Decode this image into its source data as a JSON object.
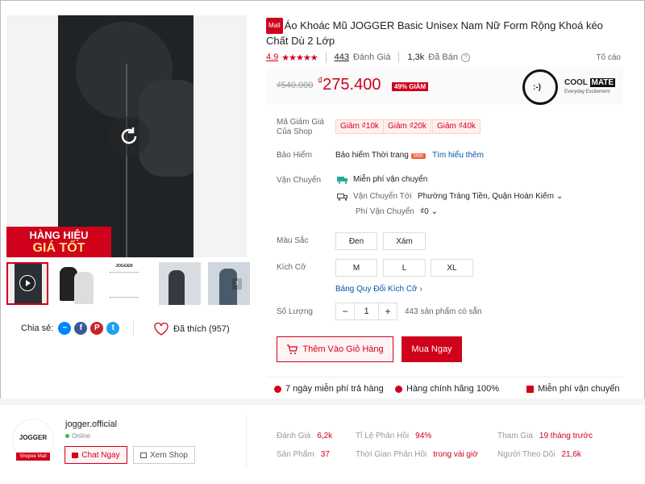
{
  "gallery": {
    "badge_line1": "HÀNG HIỆU",
    "badge_line2": "GIÁ TỐT",
    "thumb3_caption": "JOGGER"
  },
  "share": {
    "label": "Chia sẻ:",
    "icons": [
      "messenger-icon",
      "facebook-icon",
      "pinterest-icon",
      "twitter-icon"
    ],
    "liked_label": "Đã thích (957)"
  },
  "product": {
    "mall_tag": "Mall",
    "title": "Áo Khoác Mũ JOGGER Basic Unisex Nam Nữ Form Rộng Khoá kéo Chất Dù 2 Lớp",
    "rating": "4.9",
    "reviews_count": "443",
    "reviews_label": "Đánh Giá",
    "sold_count": "1,3k",
    "sold_label": "Đã Bán",
    "report": "Tố cáo"
  },
  "price": {
    "old": "₫540.000",
    "currency": "₫",
    "new": "275.400",
    "discount": "49% GIẢM"
  },
  "brand": {
    "name_left": "COOL",
    "name_right": "MATE",
    "tagline": "Everyday Excitement"
  },
  "vouchers": {
    "label": "Mã Giảm Giá Của Shop",
    "items": [
      "Giảm ₫10k",
      "Giảm ₫20k",
      "Giảm ₫40k"
    ]
  },
  "insurance": {
    "label": "Bảo Hiểm",
    "value": "Bảo hiểm Thời trang",
    "new_tag": "Mới",
    "learn_more": "Tìm hiểu thêm"
  },
  "shipping": {
    "label": "Vận Chuyển",
    "free": "Miễn phí vận chuyển",
    "to_label": "Vận Chuyển Tới",
    "to_value": "Phường Tràng Tiền, Quận Hoàn Kiếm",
    "fee_label": "Phí Vận Chuyển",
    "fee_value": "₫0"
  },
  "color": {
    "label": "Màu Sắc",
    "options": [
      "Đen",
      "Xám"
    ]
  },
  "size": {
    "label": "Kích Cỡ",
    "options": [
      "M",
      "L",
      "XL"
    ],
    "guide": "Bảng Quy Đổi Kích Cỡ"
  },
  "quantity": {
    "label": "Số Lượng",
    "minus": "−",
    "value": "1",
    "plus": "+",
    "stock": "443 sản phẩm có sẵn"
  },
  "actions": {
    "add_cart": "Thêm Vào Giỏ Hàng",
    "buy_now": "Mua Ngay"
  },
  "guarantees": {
    "return": "7 ngày miễn phí trả hàng",
    "genuine": "Hàng chính hãng 100%",
    "free_ship": "Miễn phí vận chuyển"
  },
  "shop": {
    "logo_text": "JOGGER",
    "mall_badge": "Shopee Mall",
    "name": "jogger.official",
    "status": "Online",
    "chat": "Chat Ngay",
    "view": "Xem Shop",
    "metrics": [
      {
        "k": "Đánh Giá",
        "v": "6,2k"
      },
      {
        "k": "Sản Phẩm",
        "v": "37"
      },
      {
        "k": "Tỉ Lệ Phản Hồi",
        "v": "94%"
      },
      {
        "k": "Thời Gian Phản Hồi",
        "v": "trong vài giờ"
      },
      {
        "k": "Tham Gia",
        "v": "19 tháng trước"
      },
      {
        "k": "Người Theo Dõi",
        "v": "21,6k"
      }
    ]
  },
  "colors": {
    "accent": "#d0011b",
    "link": "#0055aa"
  }
}
